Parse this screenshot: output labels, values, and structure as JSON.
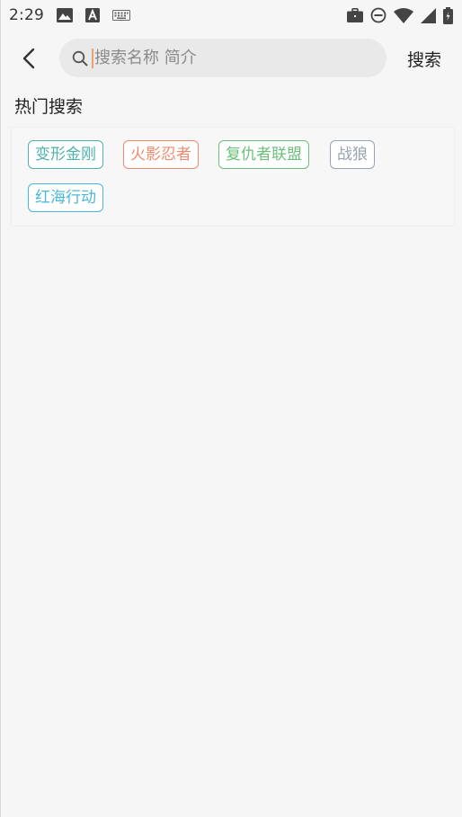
{
  "status_bar": {
    "time": "2:29",
    "left_icons": [
      "image-icon",
      "font-a-icon",
      "keyboard-icon"
    ],
    "right_icons": [
      "briefcase-icon",
      "do-not-disturb-icon",
      "wifi-icon",
      "signal-icon",
      "battery-icon"
    ]
  },
  "search": {
    "placeholder": "搜索名称 简介",
    "value": "",
    "button_label": "搜索"
  },
  "hot_search": {
    "title": "热门搜索",
    "tags": [
      {
        "label": "变形金刚",
        "color": "#4fb3a9"
      },
      {
        "label": "火影忍者",
        "color": "#f08a6e"
      },
      {
        "label": "复仇者联盟",
        "color": "#6cbf7a"
      },
      {
        "label": "战狼",
        "color": "#9aa3b0"
      },
      {
        "label": "红海行动",
        "color": "#4ab7d8"
      }
    ]
  },
  "colors": {
    "background": "#f6f6f6",
    "search_box": "#e9e9e9",
    "caret": "#f0a070"
  }
}
